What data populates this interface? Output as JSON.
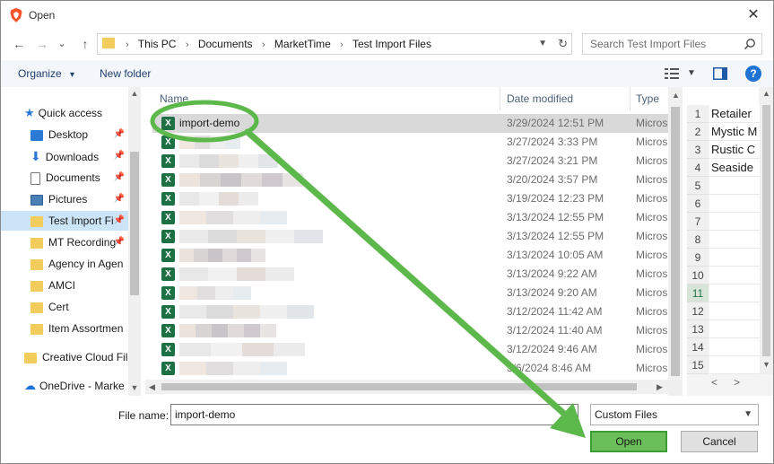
{
  "window": {
    "title": "Open",
    "close_glyph": "✕"
  },
  "nav": {
    "back_glyph": "←",
    "forward_glyph": "→",
    "recent_glyph": "⌄",
    "up_glyph": "↑"
  },
  "address": {
    "crumbs": [
      "This PC",
      "Documents",
      "MarketTime",
      "Test Import Files"
    ],
    "separator": "›"
  },
  "search": {
    "placeholder": "Search Test Import Files"
  },
  "toolbar": {
    "organize_label": "Organize",
    "organize_caret": "▾",
    "new_folder_label": "New folder",
    "help_label": "?"
  },
  "sidebar": {
    "items": [
      {
        "label": "Quick access",
        "icon": "star-icon"
      },
      {
        "label": "Desktop",
        "icon": "desktop-icon",
        "pinned": true
      },
      {
        "label": "Downloads",
        "icon": "download-icon",
        "pinned": true
      },
      {
        "label": "Documents",
        "icon": "document-icon",
        "pinned": true
      },
      {
        "label": "Pictures",
        "icon": "pictures-icon",
        "pinned": true
      },
      {
        "label": "Test Import Fi",
        "icon": "folder-icon",
        "pinned": true,
        "selected": true
      },
      {
        "label": "MT Recording",
        "icon": "folder-icon",
        "pinned": true
      },
      {
        "label": "Agency in Agen",
        "icon": "folder-icon"
      },
      {
        "label": "AMCI",
        "icon": "folder-icon"
      },
      {
        "label": "Cert",
        "icon": "folder-icon"
      },
      {
        "label": "Item Assortmen",
        "icon": "folder-icon"
      },
      {
        "label": "Creative Cloud Fil",
        "icon": "folder-icon"
      },
      {
        "label": "OneDrive - Marke",
        "icon": "cloud-icon"
      }
    ]
  },
  "columns": {
    "name": "Name",
    "date_modified": "Date modified",
    "type": "Type"
  },
  "files": [
    {
      "name": "import-demo",
      "date": "3/29/2024 12:51 PM",
      "type": "Micros",
      "selected": true
    },
    {
      "name": "",
      "date": "3/27/2024 3:33 PM",
      "type": "Micros"
    },
    {
      "name": "",
      "date": "3/27/2024 3:21 PM",
      "type": "Micros"
    },
    {
      "name": "",
      "date": "3/20/2024 3:57 PM",
      "type": "Micros"
    },
    {
      "name": "",
      "date": "3/19/2024 12:23 PM",
      "type": "Micros"
    },
    {
      "name": "",
      "date": "3/13/2024 12:55 PM",
      "type": "Micros"
    },
    {
      "name": "",
      "date": "3/13/2024 12:55 PM",
      "type": "Micros"
    },
    {
      "name": "",
      "date": "3/13/2024 10:05 AM",
      "type": "Micros"
    },
    {
      "name": "",
      "date": "3/13/2024 9:22 AM",
      "type": "Micros"
    },
    {
      "name": "",
      "date": "3/13/2024 9:20 AM",
      "type": "Micros"
    },
    {
      "name": "",
      "date": "3/12/2024 11:42 AM",
      "type": "Micros"
    },
    {
      "name": "",
      "date": "3/12/2024 11:40 AM",
      "type": "Micros"
    },
    {
      "name": "",
      "date": "3/12/2024 9:46 AM",
      "type": "Micros"
    },
    {
      "name": "",
      "date": "3/6/2024 8:46 AM",
      "type": "Micros"
    }
  ],
  "preview": {
    "row_numbers": [
      "1",
      "2",
      "3",
      "4",
      "5",
      "6",
      "7",
      "8",
      "9",
      "10",
      "11",
      "12",
      "13",
      "14",
      "15"
    ],
    "cells": [
      "Retailer",
      "Mystic M",
      "Rustic C",
      "Seaside"
    ],
    "highlighted_row": "11"
  },
  "bottom": {
    "file_name_label": "File name:",
    "file_name_value": "import-demo",
    "filter_value": "Custom Files",
    "open_label": "Open",
    "cancel_label": "Cancel"
  },
  "colors": {
    "annotation_green": "#5cb84a",
    "selection_blue": "#cce4f7",
    "excel_green": "#1d7044"
  }
}
